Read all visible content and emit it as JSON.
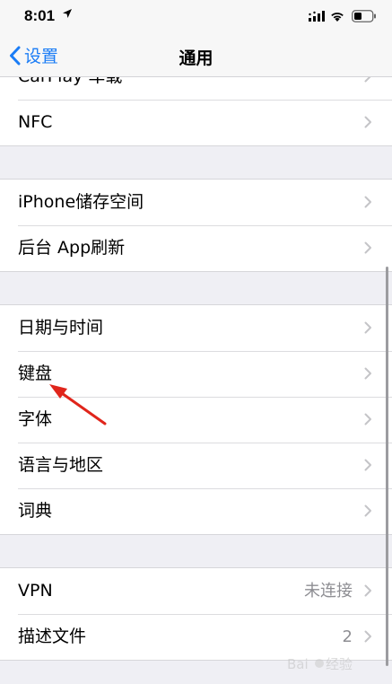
{
  "status_bar": {
    "time": "8:01"
  },
  "nav": {
    "back_label": "设置",
    "title": "通用"
  },
  "groups": [
    {
      "rows": [
        {
          "label": "CarPlay 车载"
        },
        {
          "label": "NFC"
        }
      ]
    },
    {
      "rows": [
        {
          "label": "iPhone储存空间"
        },
        {
          "label": "后台 App刷新"
        }
      ]
    },
    {
      "rows": [
        {
          "label": "日期与时间"
        },
        {
          "label": "键盘"
        },
        {
          "label": "字体"
        },
        {
          "label": "语言与地区"
        },
        {
          "label": "词典"
        }
      ]
    },
    {
      "rows": [
        {
          "label": "VPN",
          "value": "未连接"
        },
        {
          "label": "描述文件",
          "value": "2"
        }
      ]
    }
  ],
  "colors": {
    "accent": "#1a7cf6",
    "annotation_arrow": "#e0251b"
  },
  "watermark": "Baidu 经验"
}
